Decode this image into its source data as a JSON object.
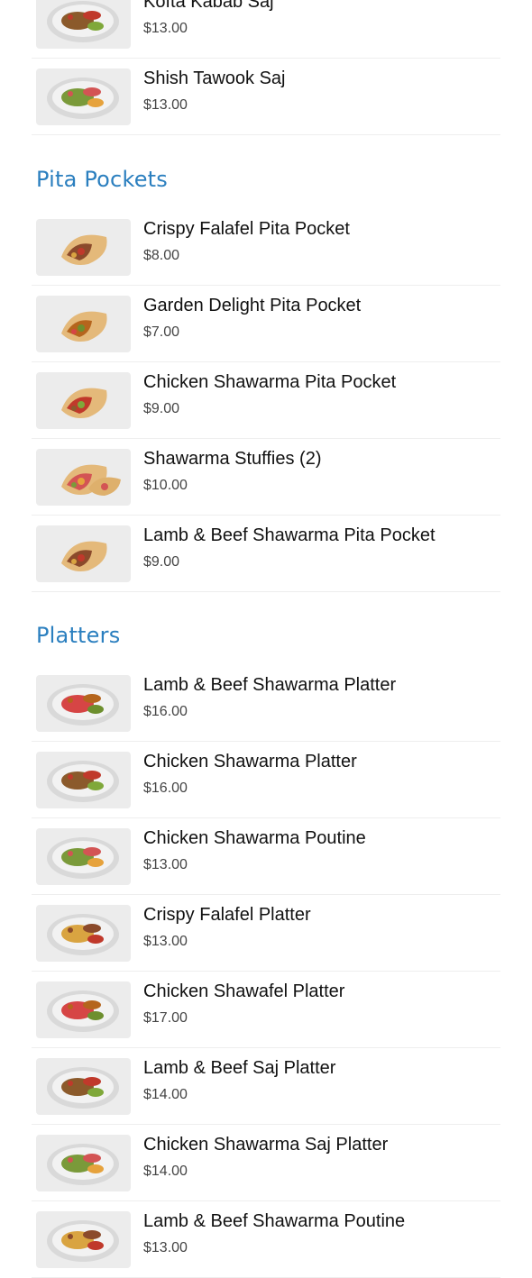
{
  "sections": [
    {
      "title": "",
      "items": [
        {
          "name": "Kofta Kabab Saj",
          "price": "$13.00",
          "image": "kofta-kabab-saj-image"
        },
        {
          "name": "Shish Tawook Saj",
          "price": "$13.00",
          "image": "shish-tawook-saj-image"
        }
      ]
    },
    {
      "title": "Pita Pockets",
      "items": [
        {
          "name": "Crispy Falafel Pita Pocket",
          "price": "$8.00",
          "image": "crispy-falafel-pita-pocket-image"
        },
        {
          "name": "Garden Delight Pita Pocket",
          "price": "$7.00",
          "image": "garden-delight-pita-pocket-image"
        },
        {
          "name": "Chicken Shawarma Pita Pocket",
          "price": "$9.00",
          "image": "chicken-shawarma-pita-pocket-image"
        },
        {
          "name": "Shawarma Stuffies (2)",
          "price": "$10.00",
          "image": "shawarma-stuffies-image"
        },
        {
          "name": "Lamb & Beef Shawarma Pita Pocket",
          "price": "$9.00",
          "image": "lamb-beef-shawarma-pita-pocket-image"
        }
      ]
    },
    {
      "title": "Platters",
      "items": [
        {
          "name": "Lamb & Beef Shawarma Platter",
          "price": "$16.00",
          "image": "lamb-beef-shawarma-platter-image"
        },
        {
          "name": "Chicken Shawarma Platter",
          "price": "$16.00",
          "image": "chicken-shawarma-platter-image"
        },
        {
          "name": "Chicken Shawarma Poutine",
          "price": "$13.00",
          "image": "chicken-shawarma-poutine-image"
        },
        {
          "name": "Crispy Falafel Platter",
          "price": "$13.00",
          "image": "crispy-falafel-platter-image"
        },
        {
          "name": "Chicken Shawafel Platter",
          "price": "$17.00",
          "image": "chicken-shawafel-platter-image"
        },
        {
          "name": "Lamb & Beef Saj Platter",
          "price": "$14.00",
          "image": "lamb-beef-saj-platter-image"
        },
        {
          "name": "Chicken Shawarma Saj Platter",
          "price": "$14.00",
          "image": "chicken-shawarma-saj-platter-image"
        },
        {
          "name": "Lamb & Beef Shawarma Poutine",
          "price": "$13.00",
          "image": "lamb-beef-shawarma-poutine-image"
        }
      ]
    }
  ],
  "colors": {
    "section_title": "#2b7fbf",
    "item_name": "#111111",
    "item_price": "#444444",
    "divider": "#eeeeee",
    "thumb_background": "#ececec"
  }
}
